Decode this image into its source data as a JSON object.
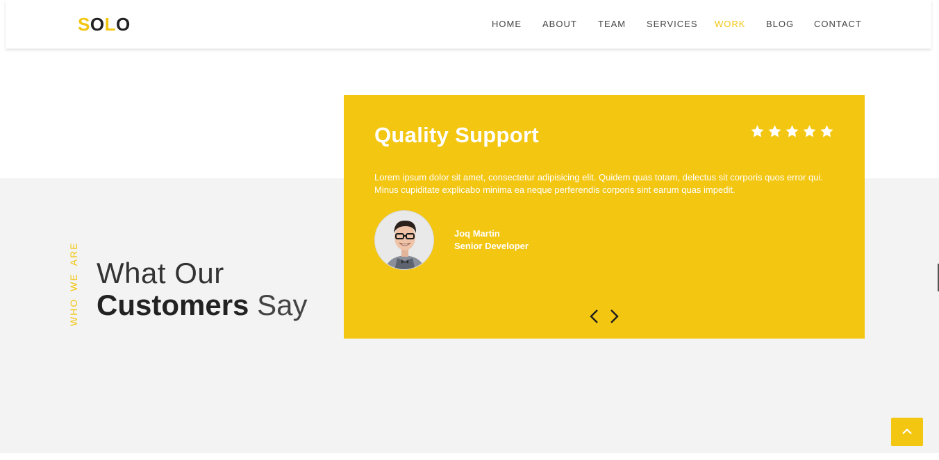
{
  "brand": {
    "logo_first": "S",
    "logo_mid": "O",
    "logo_accent": "L",
    "logo_last": "O"
  },
  "nav": {
    "items": [
      {
        "label": "HOME",
        "active": false
      },
      {
        "label": "ABOUT",
        "active": false
      },
      {
        "label": "TEAM",
        "active": false
      },
      {
        "label": "SERVICES",
        "active": false
      },
      {
        "label": "WORK",
        "active": true
      },
      {
        "label": "BLOG",
        "active": false
      },
      {
        "label": "CONTACT",
        "active": false
      }
    ]
  },
  "section": {
    "tag_words": [
      "WHO",
      "WE",
      "ARE"
    ],
    "heading_line1": "What Our",
    "heading_bold": "Customers",
    "heading_light": "Say"
  },
  "testimonial": {
    "title": "Quality Support",
    "rating": 5,
    "rating_max": 5,
    "text": "Lorem ipsum dolor sit amet, consectetur adipisicing elit. Quidem quas totam, delectus sit corporis quos error qui. Minus cupiditate explicabo minima ea neque perferendis corporis sint earum quas impedit.",
    "author_name": "Joq Martin",
    "author_role": "Senior Developer"
  },
  "icons": {
    "star": "star-icon",
    "prev": "chevron-left-icon",
    "next": "chevron-right-icon",
    "scroll_top": "chevron-up-icon"
  },
  "colors": {
    "accent": "#f3c612",
    "band": "#f3f3f3",
    "text_dark": "#222222"
  }
}
